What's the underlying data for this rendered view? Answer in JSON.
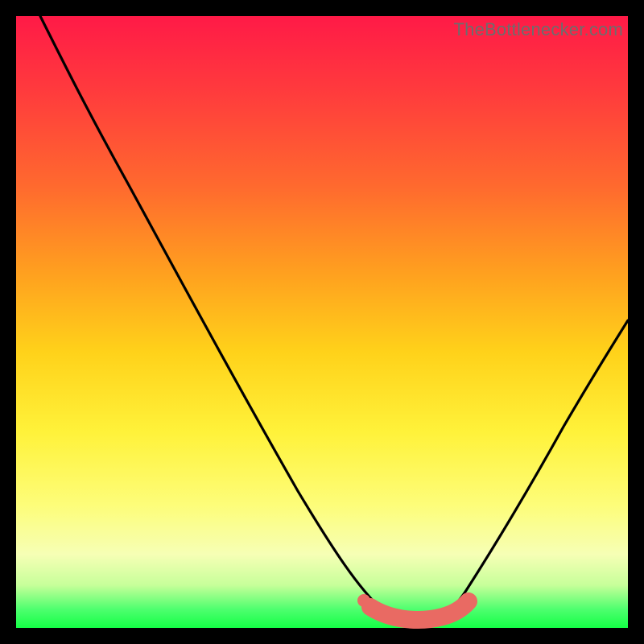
{
  "watermark": "TheBottlenecker.com",
  "chart_data": {
    "type": "line",
    "title": "",
    "xlabel": "",
    "ylabel": "",
    "xlim": [
      0,
      100
    ],
    "ylim": [
      0,
      100
    ],
    "series": [
      {
        "name": "bottleneck-curve",
        "x": [
          4,
          10,
          20,
          30,
          40,
          50,
          55,
          58,
          60,
          63,
          67,
          70,
          72,
          76,
          82,
          90,
          100
        ],
        "y": [
          100,
          91,
          76,
          61,
          46,
          30,
          21,
          14,
          8,
          3,
          1.5,
          1.5,
          3,
          8,
          18,
          32,
          48
        ]
      }
    ],
    "highlight_band": {
      "name": "optimal-zone",
      "color": "#e96a63",
      "x": [
        57,
        73
      ],
      "y_center": 2.4,
      "thickness_pct": 2.6,
      "dot_x": 57
    },
    "background_gradient": {
      "stops": [
        {
          "pct": 0,
          "color": "#ff1a47"
        },
        {
          "pct": 28,
          "color": "#ff6a2e"
        },
        {
          "pct": 55,
          "color": "#ffd21a"
        },
        {
          "pct": 80,
          "color": "#fdfd7a"
        },
        {
          "pct": 97,
          "color": "#4dff6e"
        },
        {
          "pct": 100,
          "color": "#14ff46"
        }
      ]
    }
  }
}
